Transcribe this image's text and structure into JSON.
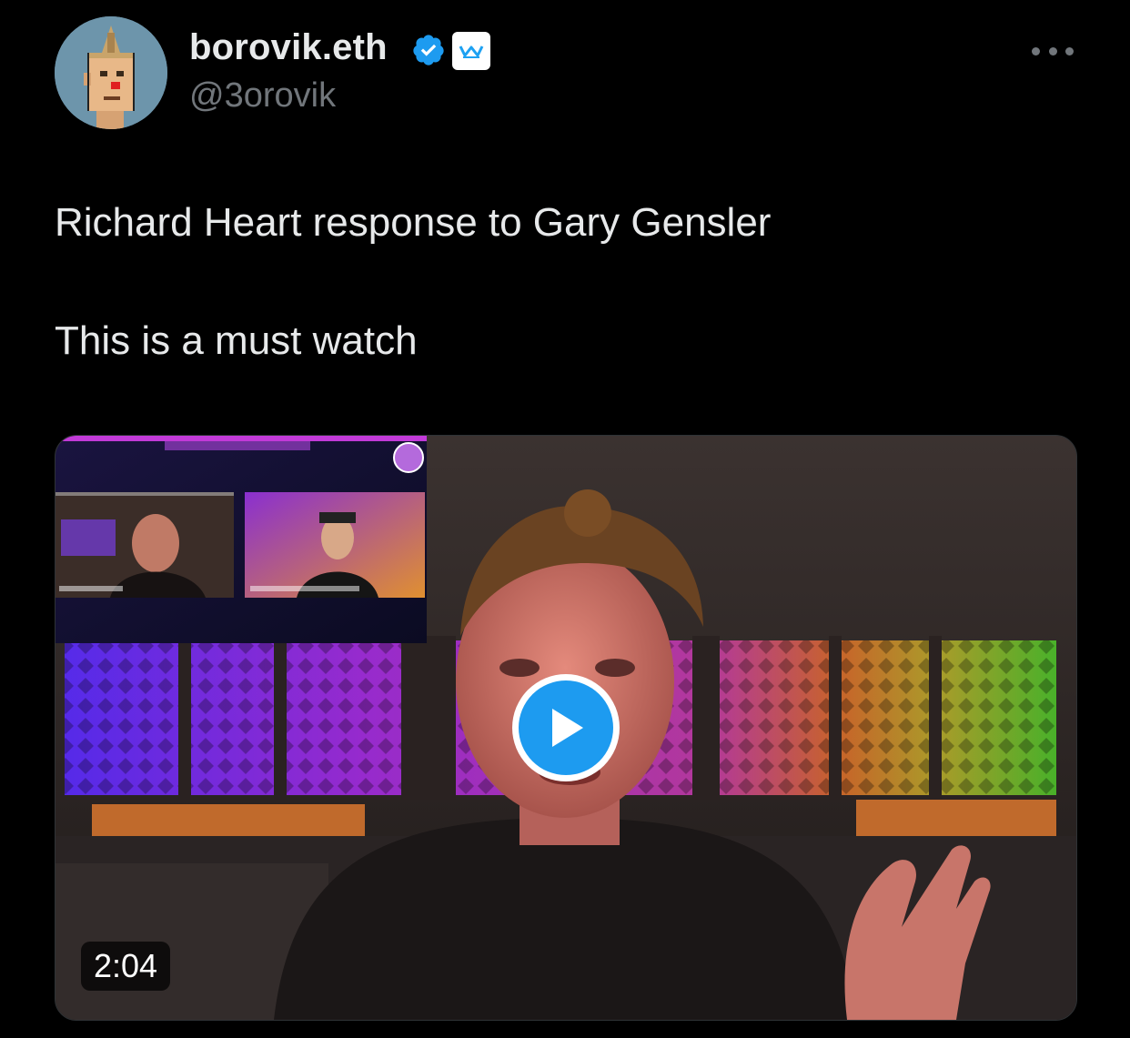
{
  "author": {
    "display_name": "borovik.eth",
    "handle": "@3orovik",
    "verified": true,
    "affiliate_badge_icon": "affiliate-badge-icon",
    "avatar_icon": "pixel-punk-avatar"
  },
  "tweet": {
    "lines": [
      "Richard Heart response to Gary Gensler",
      "This is a must watch"
    ]
  },
  "media": {
    "type": "video",
    "duration": "2:04",
    "play_icon": "play-icon"
  },
  "colors": {
    "background": "#000000",
    "text_primary": "#e7e9ea",
    "text_secondary": "#71767b",
    "accent": "#1d9bf0"
  }
}
